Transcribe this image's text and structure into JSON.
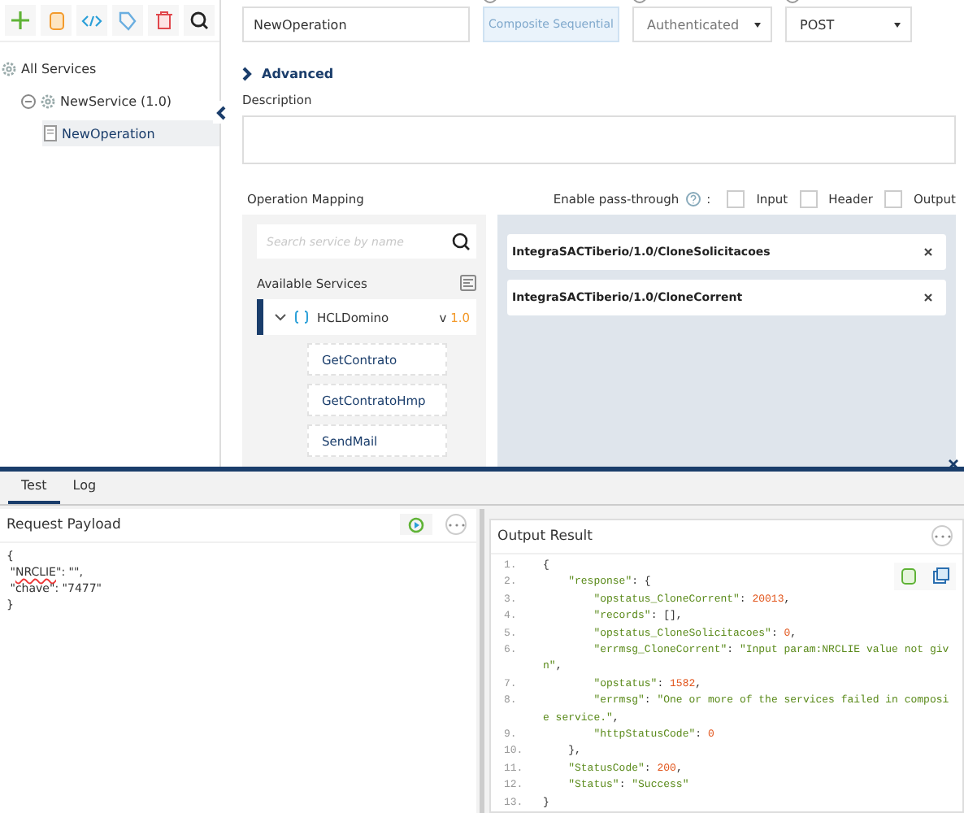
{
  "toolbar": [
    {
      "kind": "add"
    },
    {
      "kind": "file"
    },
    {
      "kind": "code"
    },
    {
      "kind": "tag"
    },
    {
      "kind": "delete"
    },
    {
      "kind": "search"
    }
  ],
  "tree": [
    {
      "label": "All Services",
      "selected": false,
      "children": [
        {
          "label": "NewService (1.0)",
          "expanded": true,
          "selected": false,
          "children": [
            {
              "label": "NewOperation",
              "selected": true
            }
          ]
        }
      ]
    }
  ],
  "form": {
    "name": "NewOperation",
    "type_button": {
      "label": "Composite Sequential",
      "disabled": true
    },
    "security": "Authenticated",
    "method": "POST"
  },
  "advanced": {
    "label": "Advanced",
    "expanded": false
  },
  "description": {
    "label": "Description"
  },
  "mapping": {
    "title": "Operation Mapping",
    "pass_through_label": "Enable pass-through",
    "separator": ":",
    "options": [
      {
        "label": "Input",
        "checked": false
      },
      {
        "label": "Header",
        "checked": false
      },
      {
        "label": "Output",
        "checked": false
      }
    ],
    "search": {
      "placeholder": "Search service by name"
    },
    "available_label": "Available Services",
    "service": {
      "name": "HCLDomino",
      "version_prefix": "v",
      "version": "1.0",
      "expanded": true,
      "operations": [
        "GetContrato",
        "GetContratoHmp",
        "SendMail"
      ]
    },
    "mapped": [
      "IntegraSACTiberio/1.0/CloneSolicitacoes",
      "IntegraSACTiberio/1.0/CloneCorrent"
    ]
  },
  "tabs": [
    {
      "label": "Test",
      "selected": true
    },
    {
      "label": "Log",
      "selected": false
    }
  ],
  "request": {
    "title": "Request Payload",
    "lines": [
      [
        {
          "kind": "punct",
          "text": "{"
        }
      ],
      [
        {
          "kind": "punct",
          "text": " \""
        },
        {
          "kind": "misspelled",
          "text": "NRCLIE"
        },
        {
          "kind": "punct",
          "text": "\": \"\","
        }
      ],
      [
        {
          "kind": "punct",
          "text": " \"chave\": \"7477\""
        }
      ],
      [
        {
          "kind": "punct",
          "text": "}"
        }
      ]
    ]
  },
  "output": {
    "title": "Output Result",
    "lines": [
      {
        "number": "1.",
        "tokens": [
          {
            "kind": "punct",
            "text": "{"
          }
        ]
      },
      {
        "number": "2.",
        "tokens": [
          {
            "kind": "key",
            "text": "    \"response\""
          },
          {
            "kind": "punct",
            "text": ": {"
          }
        ]
      },
      {
        "number": "3.",
        "tokens": [
          {
            "kind": "key",
            "text": "        \"opstatus_CloneCorrent\""
          },
          {
            "kind": "punct",
            "text": ": "
          },
          {
            "kind": "number",
            "text": "20013"
          },
          {
            "kind": "punct",
            "text": ","
          }
        ]
      },
      {
        "number": "4.",
        "tokens": [
          {
            "kind": "key",
            "text": "        \"records\""
          },
          {
            "kind": "punct",
            "text": ": [],"
          }
        ]
      },
      {
        "number": "5.",
        "tokens": [
          {
            "kind": "key",
            "text": "        \"opstatus_CloneSolicitacoes\""
          },
          {
            "kind": "punct",
            "text": ": "
          },
          {
            "kind": "number",
            "text": "0"
          },
          {
            "kind": "punct",
            "text": ","
          }
        ]
      },
      {
        "number": "6.",
        "tokens": [
          {
            "kind": "key",
            "text": "        \"errmsg_CloneCorrent\""
          },
          {
            "kind": "punct",
            "text": ": "
          },
          {
            "kind": "string",
            "text": "\"Input param:NRCLIE value not giv"
          }
        ]
      },
      {
        "tokens": [
          {
            "kind": "string",
            "text": "n\""
          },
          {
            "kind": "punct",
            "text": ","
          }
        ]
      },
      {
        "number": "7.",
        "tokens": [
          {
            "kind": "key",
            "text": "        \"opstatus\""
          },
          {
            "kind": "punct",
            "text": ": "
          },
          {
            "kind": "number",
            "text": "1582"
          },
          {
            "kind": "punct",
            "text": ","
          }
        ]
      },
      {
        "number": "8.",
        "tokens": [
          {
            "kind": "key",
            "text": "        \"errmsg\""
          },
          {
            "kind": "punct",
            "text": ": "
          },
          {
            "kind": "string",
            "text": "\"One or more of the services failed in composi"
          }
        ]
      },
      {
        "tokens": [
          {
            "kind": "string",
            "text": "e service.\""
          },
          {
            "kind": "punct",
            "text": ","
          }
        ]
      },
      {
        "number": "9.",
        "tokens": [
          {
            "kind": "key",
            "text": "        \"httpStatusCode\""
          },
          {
            "kind": "punct",
            "text": ": "
          },
          {
            "kind": "number",
            "text": "0"
          }
        ]
      },
      {
        "number": "10.",
        "tokens": [
          {
            "kind": "punct",
            "text": "    },"
          }
        ]
      },
      {
        "number": "11.",
        "tokens": [
          {
            "kind": "key",
            "text": "    \"StatusCode\""
          },
          {
            "kind": "punct",
            "text": ": "
          },
          {
            "kind": "number",
            "text": "200"
          },
          {
            "kind": "punct",
            "text": ","
          }
        ]
      },
      {
        "number": "12.",
        "tokens": [
          {
            "kind": "key",
            "text": "    \"Status\""
          },
          {
            "kind": "punct",
            "text": ": "
          },
          {
            "kind": "string",
            "text": "\"Success\""
          }
        ]
      },
      {
        "number": "13.",
        "tokens": [
          {
            "kind": "punct",
            "text": "}"
          }
        ]
      }
    ]
  }
}
